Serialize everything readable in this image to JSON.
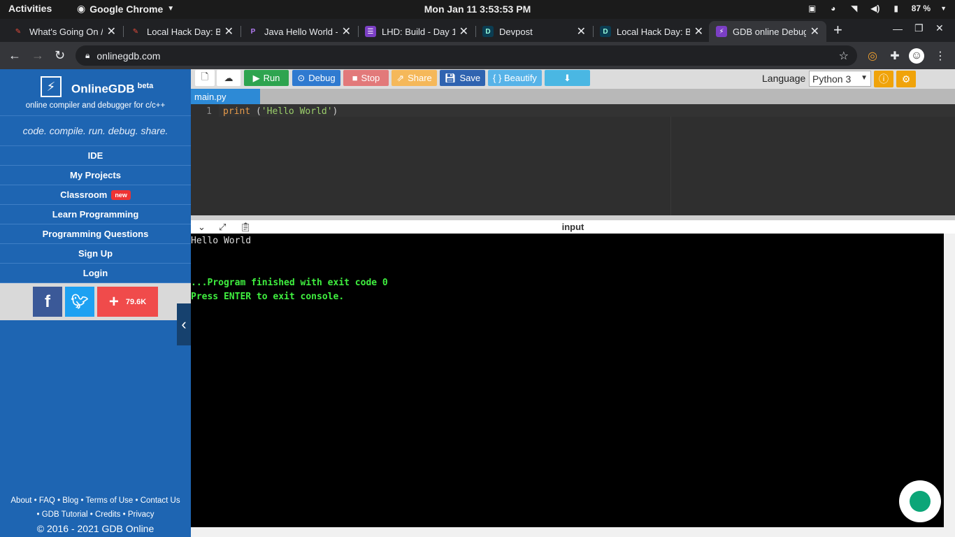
{
  "system": {
    "activities": "Activities",
    "app_name": "Google Chrome",
    "clock": "Mon Jan 11   3:53:53 PM",
    "battery": "87 %"
  },
  "browser": {
    "tabs": [
      {
        "title": "What's Going On /",
        "fav_color": "#c0392b",
        "fav_char": "✎"
      },
      {
        "title": "Local Hack Day: Bu",
        "fav_color": "#c0392b",
        "fav_char": "✎"
      },
      {
        "title": "Java Hello World -",
        "fav_color": "#6f42c1",
        "fav_char": "P"
      },
      {
        "title": "LHD: Build - Day 1",
        "fav_color": "#6f42c1",
        "fav_char": "☰"
      },
      {
        "title": "Devpost",
        "fav_color": "#003e54",
        "fav_char": "D"
      },
      {
        "title": "Local Hack Day: Bu",
        "fav_color": "#003e54",
        "fav_char": "D"
      },
      {
        "title": "GDB online Debug",
        "fav_color": "#7a3fbf",
        "fav_char": "⚡"
      }
    ],
    "url": "onlinegdb.com"
  },
  "sidebar": {
    "brand_name": "OnlineGDB",
    "brand_beta": "beta",
    "brand_sub": "online compiler and debugger for c/c++",
    "tagline": "code. compile. run. debug. share.",
    "menu": [
      {
        "label": "IDE"
      },
      {
        "label": "My Projects"
      },
      {
        "label": "Classroom",
        "badge": "new"
      },
      {
        "label": "Learn Programming"
      },
      {
        "label": "Programming Questions"
      },
      {
        "label": "Sign Up"
      },
      {
        "label": "Login"
      }
    ],
    "share_count": "79.6K",
    "footer_line1": [
      "About",
      "FAQ",
      "Blog",
      "Terms of Use",
      "Contact Us"
    ],
    "footer_line2": [
      "GDB Tutorial",
      "Credits",
      "Privacy"
    ],
    "copyright": "© 2016 - 2021 GDB Online"
  },
  "ide": {
    "buttons": {
      "run": "Run",
      "debug": "Debug",
      "stop": "Stop",
      "share": "Share",
      "save": "Save",
      "beautify": "{ } Beautify"
    },
    "language_label": "Language",
    "language_value": "Python 3",
    "file_tab": "main.py",
    "line_number": "1",
    "code": {
      "kw": "print",
      "open": " (",
      "str": "'Hello World'",
      "close": ")"
    },
    "console_label": "input",
    "console_output": "Hello World",
    "exit_message": "...Program finished with exit code 0",
    "enter_message": "Press ENTER to exit console."
  }
}
